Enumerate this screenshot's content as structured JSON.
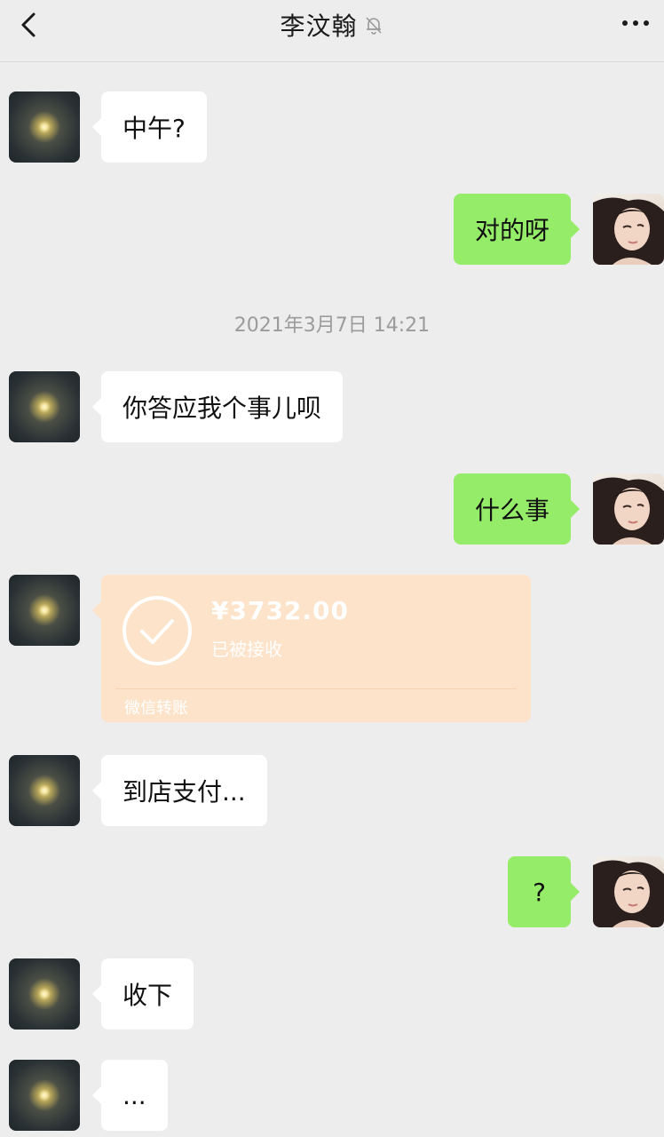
{
  "header": {
    "title": "李汶翰",
    "back_icon": "chevron-left-icon",
    "mute_icon": "bell-off-icon",
    "more_icon": "more-dots-icon"
  },
  "messages": [
    {
      "from": "contact",
      "type": "text",
      "text": "中午?"
    },
    {
      "from": "me",
      "type": "text",
      "text": "对的呀"
    },
    {
      "type": "time",
      "text": "2021年3月7日 14:21"
    },
    {
      "from": "contact",
      "type": "text",
      "text": "你答应我个事儿呗"
    },
    {
      "from": "me",
      "type": "text",
      "text": "什么事"
    },
    {
      "from": "contact",
      "type": "transfer",
      "amount": "¥3732.00",
      "status": "已被接收",
      "label": "微信转账"
    },
    {
      "from": "contact",
      "type": "text",
      "text": "到店支付..."
    },
    {
      "from": "me",
      "type": "text",
      "text": "?"
    },
    {
      "from": "contact",
      "type": "text",
      "text": "收下"
    },
    {
      "from": "contact",
      "type": "text",
      "text": "..."
    }
  ],
  "colors": {
    "background": "#ededed",
    "incoming_bubble": "#ffffff",
    "outgoing_bubble": "#95ec69",
    "transfer_card": "#fde3c9"
  }
}
